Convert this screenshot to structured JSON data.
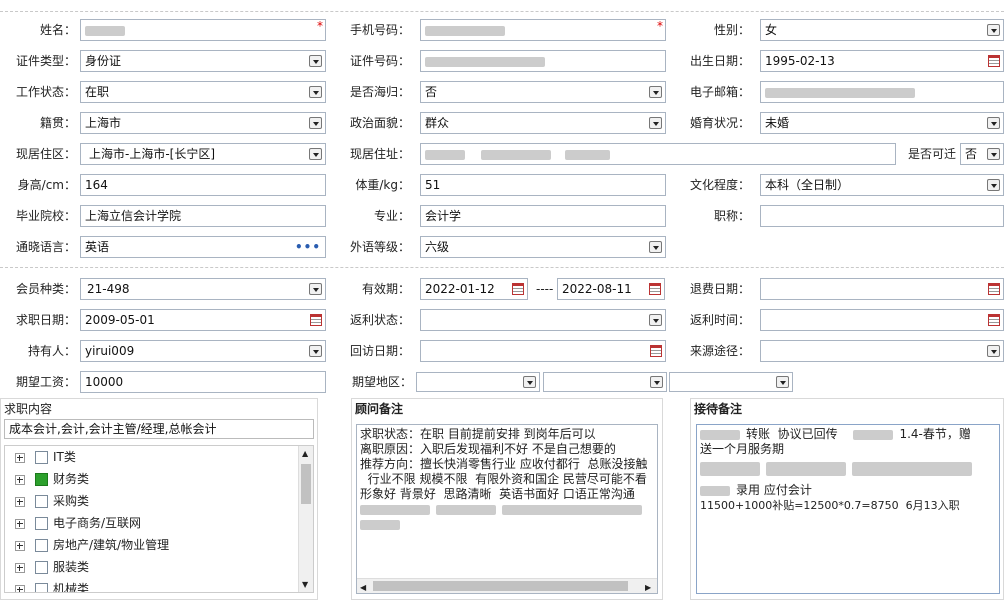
{
  "form": {
    "name_label": "姓名：",
    "phone_label": "手机号码：",
    "gender_label": "性别：",
    "gender_value": "女",
    "id_type_label": "证件类型：",
    "id_type_value": "身份证",
    "id_no_label": "证件号码：",
    "birth_label": "出生日期：",
    "birth_value": "1995-02-13",
    "work_status_label": "工作状态：",
    "work_status_value": "在职",
    "overseas_label": "是否海归：",
    "overseas_value": "否",
    "email_label": "电子邮箱：",
    "native_label": "籍贯：",
    "native_value": "上海市",
    "politics_label": "政治面貌：",
    "politics_value": "群众",
    "marital_label": "婚育状况：",
    "marital_value": "未婚",
    "residence_area_label": "现居住区：",
    "residence_area_value": "上海市-上海市-[长宁区]",
    "residence_addr_label": "现居住址：",
    "relocate_label": "是否可迁",
    "relocate_value": "否",
    "height_label": "身高/cm：",
    "height_value": "164",
    "weight_label": "体重/kg：",
    "weight_value": "51",
    "education_label": "文化程度：",
    "education_value": "本科（全日制）",
    "school_label": "毕业院校：",
    "school_value": "上海立信会计学院",
    "major_label": "专业：",
    "major_value": "会计学",
    "title_label": "职称：",
    "title_value": "",
    "language_label": "通晓语言：",
    "language_value": "英语",
    "lang_level_label": "外语等级：",
    "lang_level_value": "六级",
    "member_type_label": "会员种类：",
    "member_type_value": "21-498",
    "valid_label": "有效期：",
    "valid_from": "2022-01-12",
    "valid_sep": "----",
    "valid_to": "2022-08-11",
    "refund_date_label": "退费日期：",
    "job_date_label": "求职日期：",
    "job_date_value": "2009-05-01",
    "rebate_status_label": "返利状态：",
    "rebate_time_label": "返利时间：",
    "holder_label": "持有人：",
    "holder_value": "yirui009",
    "revisit_label": "回访日期：",
    "source_label": "来源途径：",
    "salary_label": "期望工资：",
    "salary_value": "10000",
    "region_label": "期望地区："
  },
  "job_panel": {
    "title": "求职内容",
    "summary": "成本会计,会计,会计主管/经理,总帐会计",
    "tree": [
      {
        "label": "IT类",
        "checked": false
      },
      {
        "label": "财务类",
        "checked": true
      },
      {
        "label": "采购类",
        "checked": false
      },
      {
        "label": "电子商务/互联网",
        "checked": false
      },
      {
        "label": "房地产/建筑/物业管理",
        "checked": false
      },
      {
        "label": "服装类",
        "checked": false
      },
      {
        "label": "机械类",
        "checked": false
      }
    ]
  },
  "advisor_panel": {
    "title": "顾问备注",
    "lines": [
      "求职状态：在职 目前提前安排 到岗年后可以",
      "离职原因：入职后发现福利不好 不是自己想要的",
      "推荐方向：擅长快消零售行业 应收付都行  总账没接触",
      "  行业不限 规模不限  有限外资和国企 民营尽可能不看",
      "形象好 背景好  思路清晰  英语书面好 口语正常沟通"
    ]
  },
  "reception_panel": {
    "title": "接待备注",
    "line1_a": "转账  协议已回传",
    "line1_b": "1.4-春节，赠",
    "line2": "送一个月服务期",
    "line4": "录用 应付会计",
    "line5": "11500+1000补贴=12500*0.7=8750  6月13入职"
  },
  "colors": {
    "required": "#dd0000",
    "checked": "#2ca02c",
    "border": "#a9b4c2"
  }
}
